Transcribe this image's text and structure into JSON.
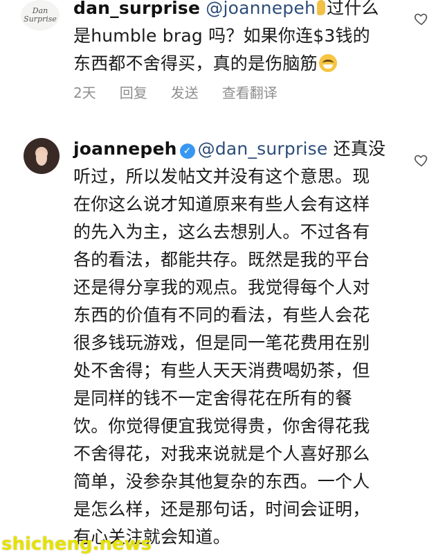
{
  "comments": [
    {
      "username": "dan_surprise",
      "avatar_label": "Dan Surprise",
      "mention": "@joannepeh",
      "text_line1_rest": "过什么",
      "text_line2": "是humble brag 吗？如果你连$3钱的",
      "text_line3": "东西都不舍得买，真的是伤脑筋",
      "emoji_icon": "grinning-sweat-emoji",
      "meta": {
        "time": "2天",
        "reply": "回复",
        "send": "发送",
        "translate": "查看翻译"
      }
    },
    {
      "username": "joannepeh",
      "mention": "@dan_surprise",
      "verified_icon": "verified-badge-icon",
      "line1_rest": "还真没",
      "lines": [
        "听过，所以发帖文并没有这个意思。现",
        "在你这么说才知道原来有些人会有这样",
        "的先入为主，这么去想别人。不过各有",
        "各的看法，都能共存。既然是我的平台",
        "还是得分享我的观点。我觉得每个人对",
        "东西的价值有不同的看法，有些人会花",
        "很多钱玩游戏，但是同一笔花费用在别",
        "处不舍得；有些人天天消费喝奶茶，但",
        "是同样的钱不一定舍得花在所有的餐",
        "饮。你觉得便宜我觉得贵，你舍得花我",
        "不舍得花，对我来说就是个人喜好那么",
        "简单，没参杂其他复杂的东西。一个人",
        "是怎么样，还是那句话，时间会证明，",
        "有心关注就会知道。"
      ]
    }
  ],
  "watermark": "shicheng.news",
  "colors": {
    "mention": "#2d4d78",
    "meta": "#8e8e8e",
    "watermark": "#e6e200",
    "verified": "#3897f0"
  }
}
